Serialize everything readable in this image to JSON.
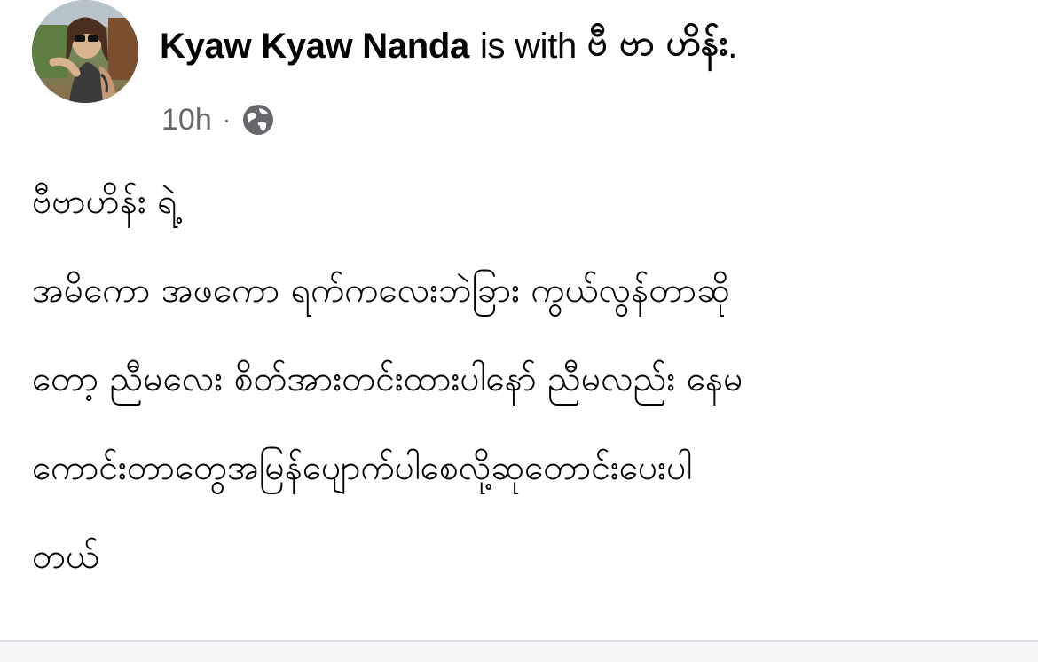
{
  "post": {
    "author": "Kyaw Kyaw Nanda",
    "with_text": "is with",
    "tagged": "ဗီ ဗာ ဟိန်း",
    "period": ".",
    "timestamp": "10h",
    "separator": "·",
    "audience_icon": "globe-icon",
    "body_lines": [
      "ဗီဗာဟိန်း ရဲ့",
      "အမိကော အဖကော ရက်ကလေးဘဲခြား ကွယ်လွန်တာဆို",
      "တော့ ညီမလေး စိတ်အားတင်းထားပါနော် ညီမလည်း နေမ",
      "ကောင်းတာတွေအမြန်ပျောက်ပါစေလို့ဆုတောင်းပေးပါ",
      "တယ်"
    ]
  },
  "colors": {
    "text_primary": "#050505",
    "text_secondary": "#65676b",
    "divider": "#dadde1"
  }
}
